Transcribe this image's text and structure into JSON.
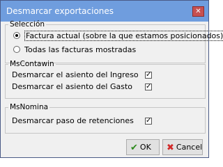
{
  "window": {
    "title": "Desmarcar exportaciones",
    "close_label": "✕"
  },
  "seleccion": {
    "legend": "Selección",
    "options": [
      {
        "label": "Factura actual (sobre la que estamos posicionados)",
        "selected": true
      },
      {
        "label": "Todas las facturas mostradas",
        "selected": false
      }
    ]
  },
  "mscontawin": {
    "legend": "MsContawin",
    "items": [
      {
        "label": "Desmarcar el asiento del  Ingreso",
        "checked": true
      },
      {
        "label": "Desmarcar el asiento del Gasto",
        "checked": true
      }
    ]
  },
  "msnomina": {
    "legend": "MsNomina",
    "items": [
      {
        "label": "Desmarcar paso de retenciones",
        "checked": true
      }
    ]
  },
  "buttons": {
    "ok_label": "OK",
    "ok_icon": "✔",
    "cancel_label": "Cancel",
    "cancel_icon": "✖"
  }
}
